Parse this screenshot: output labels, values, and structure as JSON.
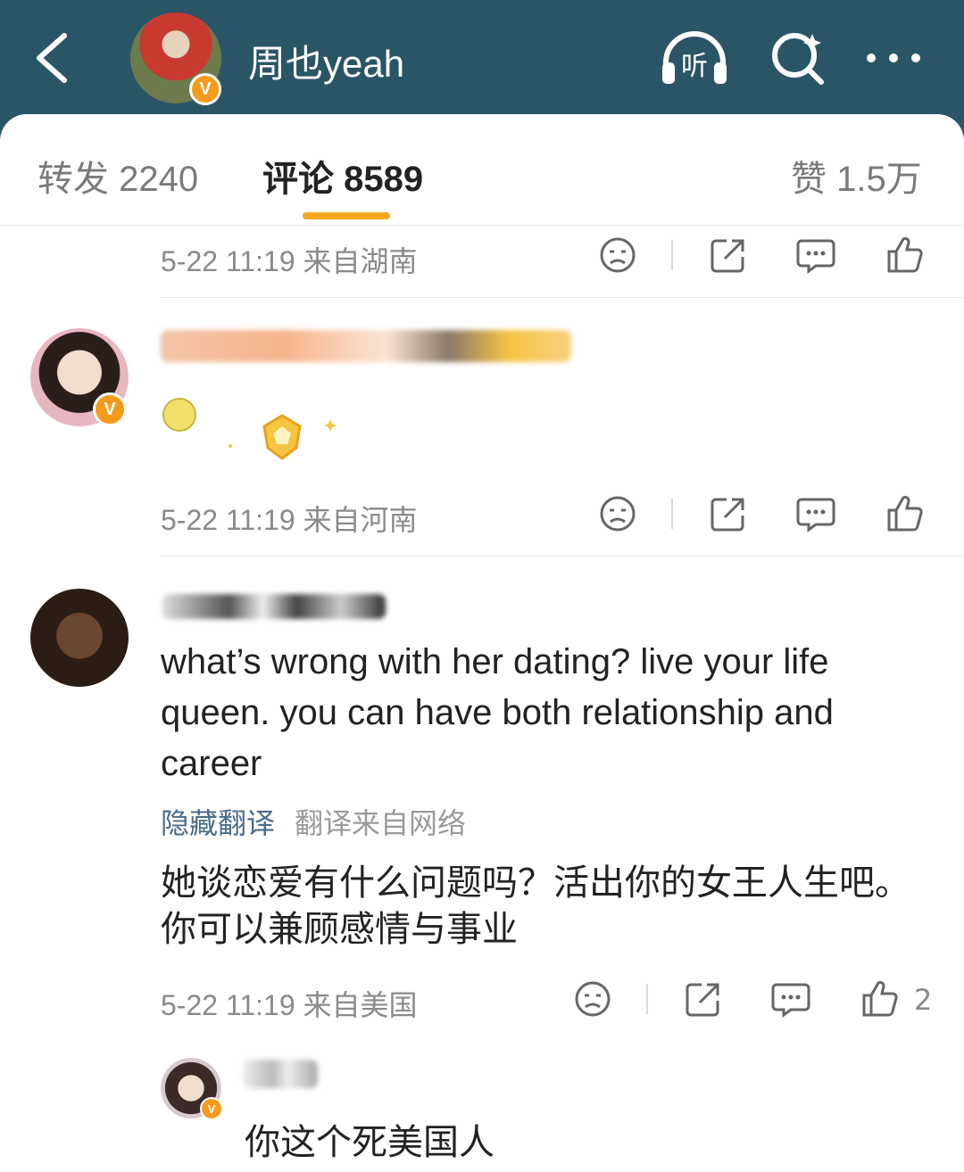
{
  "header": {
    "title": "周也yeah",
    "listen_label": "听",
    "verified_mark": "V",
    "accent_color": "#2a5567"
  },
  "tabs": [
    {
      "label": "转发 2240"
    },
    {
      "label": "评论 8589"
    },
    {
      "label": "赞 1.5万"
    }
  ],
  "comments": [
    {
      "meta": "5-22 11:19  来自湖南"
    },
    {
      "meta": "5-22 11:19  来自河南",
      "verified_mark": "V"
    },
    {
      "text": "what’s wrong with her dating? live your life queen. you can have both relationship and career",
      "translate_toggle": "隐藏翻译",
      "translate_source": "翻译来自网络",
      "translation": "她谈恋爱有什么问题吗？活出你的女王人生吧。你可以兼顾感情与事业",
      "meta": "5-22 11:19  来自美国",
      "likes": "2"
    }
  ],
  "reply": {
    "text": "你这个死美国人",
    "verified_mark": "V"
  },
  "colors": {
    "tab_indicator": "#f7a823",
    "verified_badge": "#f59a1b",
    "link": "#486b8a"
  }
}
